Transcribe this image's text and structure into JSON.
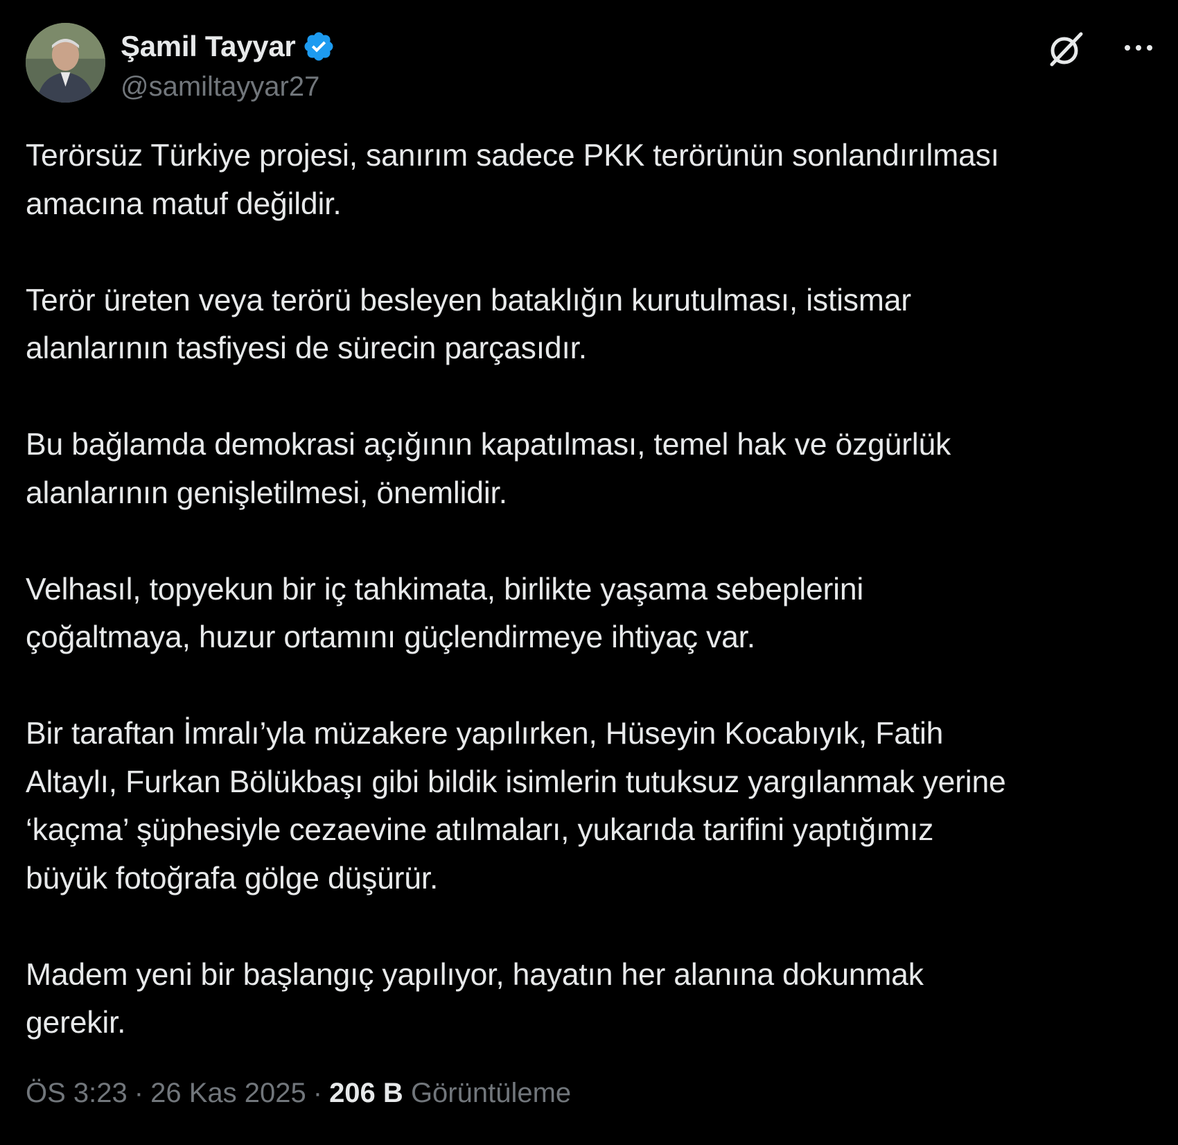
{
  "author": {
    "display_name": "Şamil Tayyar",
    "handle": "@samiltayyar27",
    "verified": true
  },
  "tweet": {
    "paragraphs": [
      "Terörsüz Türkiye projesi, sanırım sadece PKK terörünün sonlandırılması\namacına matuf değildir.",
      "Terör üreten veya terörü besleyen bataklığın kurutulması, istismar\nalanlarının tasfiyesi de sürecin parçasıdır.",
      "Bu bağlamda demokrasi açığının kapatılması, temel hak ve özgürlük\nalanlarının genişletilmesi, önemlidir.",
      "Velhasıl, topyekun bir iç tahkimata, birlikte yaşama sebeplerini\nçoğaltmaya, huzur ortamını güçlendirmeye ihtiyaç var.",
      "Bir taraftan İmralı’yla müzakere yapılırken, Hüseyin Kocabıyık, Fatih\nAltaylı, Furkan Bölükbaşı gibi bildik isimlerin tutuksuz yargılanmak yerine\n‘kaçma’ şüphesiyle cezaevine atılmaları, yukarıda tarifini yaptığımız\nbüyük fotoğrafa gölge düşürür.",
      "Madem yeni bir başlangıç yapılıyor, hayatın her alanına dokunmak\ngerekir."
    ],
    "time": "ÖS 3:23",
    "date": "26 Kas 2025",
    "separator": "·",
    "views_count": "206 B",
    "views_label": "Görüntüleme"
  },
  "icons": {
    "verified": "verified-badge-icon",
    "grok": "grok-icon",
    "more": "more-options-icon"
  },
  "colors": {
    "background": "#000000",
    "primary_text": "#e7e9ea",
    "secondary_text": "#71767b",
    "verified_blue": "#1d9bf0"
  }
}
